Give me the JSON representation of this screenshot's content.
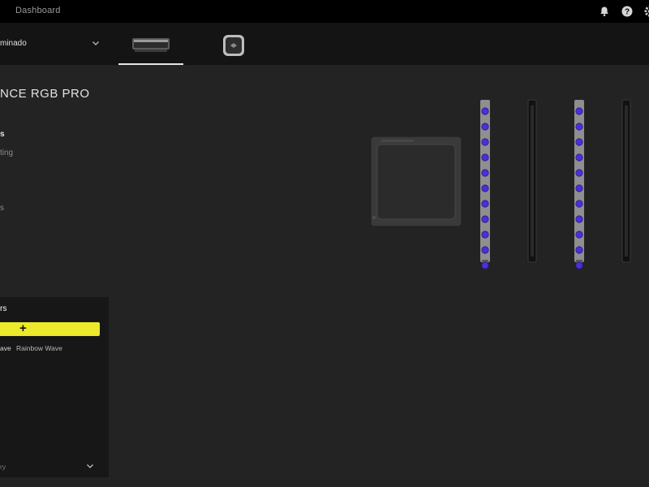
{
  "topbar": {
    "title": "Dashboard",
    "icons": [
      "bell-icon",
      "help-icon",
      "settings-icon"
    ]
  },
  "device_selector": {
    "name": "minado",
    "icon": "chevron-down-icon"
  },
  "device_tabs": [
    {
      "icon": "ram-module-icon",
      "active": true
    },
    {
      "icon": "cooler-pump-icon",
      "active": false
    }
  ],
  "page": {
    "heading": "NCE RGB PRO"
  },
  "nav": [
    {
      "label": "s"
    },
    {
      "label": "ting"
    },
    {
      "label": "s"
    }
  ],
  "effects_panel": {
    "title": "rs",
    "add_icon": "plus-icon",
    "effects": [
      "ave",
      "Rainbow Wave"
    ],
    "footer": "ry",
    "footer_icon": "chevron-down-icon"
  },
  "preview": {
    "led_color": "#4a30d9",
    "stick_color": "#8f8f8f",
    "slot_color": "#2a2a2a"
  }
}
